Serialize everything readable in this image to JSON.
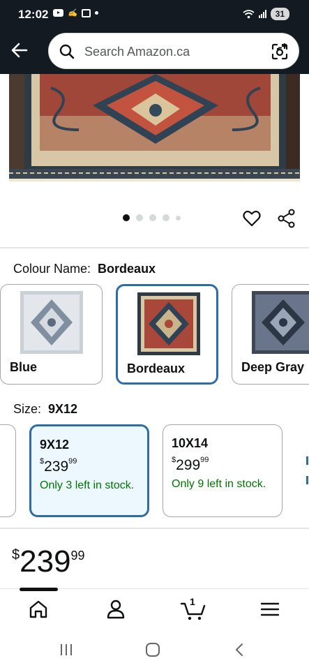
{
  "status_bar": {
    "time": "12:02",
    "battery": "31",
    "icons": [
      "youtube-icon",
      "signature-icon",
      "screenshot-icon",
      "dot-icon",
      "wifi-icon",
      "signal-icon"
    ]
  },
  "header": {
    "search_placeholder": "Search Amazon.ca",
    "icons": [
      "back-arrow-icon",
      "search-icon",
      "camera-search-icon"
    ],
    "background_color": "#131a22"
  },
  "gallery": {
    "image_count": 5,
    "active_index": 0,
    "icons": [
      "heart-icon",
      "share-icon"
    ]
  },
  "colour": {
    "label": "Colour Name:",
    "value": "Bordeaux",
    "options": [
      {
        "name": "Blue",
        "selected": false
      },
      {
        "name": "Bordeaux",
        "selected": true
      },
      {
        "name": "Deep Gray",
        "selected": false
      }
    ]
  },
  "size": {
    "label": "Size:",
    "value": "9X12",
    "options": [
      {
        "name": "9X12",
        "currency": "$",
        "whole": "239",
        "cents": "99",
        "stock": "Only 3 left in stock.",
        "selected": true
      },
      {
        "name": "10X14",
        "currency": "$",
        "whole": "299",
        "cents": "99",
        "stock": "Only 9 left in stock.",
        "selected": false
      }
    ]
  },
  "price": {
    "currency": "$",
    "whole": "239",
    "cents": "99"
  },
  "bottom_nav": {
    "items": [
      "home-icon",
      "account-icon",
      "cart-icon",
      "menu-icon"
    ],
    "cart_count": "1",
    "active": "home"
  },
  "colors": {
    "accent_blue": "#2e6da4",
    "stock_green": "#007600",
    "header_dark": "#131a22"
  }
}
